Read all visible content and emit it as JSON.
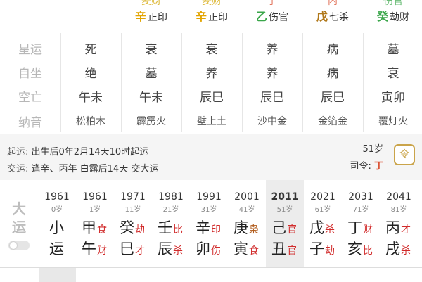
{
  "top_row": [
    {
      "cut": "羑财",
      "stem": "辛",
      "god": "正印"
    },
    {
      "cut": "羑财",
      "stem": "辛",
      "god": "正印"
    },
    {
      "cut": "了",
      "stem": "乙",
      "god": "伤官"
    },
    {
      "cut": "内",
      "stem": "戊",
      "god": "七杀"
    },
    {
      "cut": "伤官",
      "stem": "癸",
      "god": "劫财"
    }
  ],
  "rows": [
    {
      "label": "星运",
      "values": [
        "死",
        "衰",
        "衰",
        "养",
        "病",
        "墓"
      ]
    },
    {
      "label": "自坐",
      "values": [
        "绝",
        "墓",
        "养",
        "养",
        "病",
        "衰"
      ]
    },
    {
      "label": "空亡",
      "values": [
        "午未",
        "午未",
        "辰巳",
        "辰巳",
        "辰巳",
        "寅卯"
      ]
    },
    {
      "label": "纳音",
      "values": [
        "松柏木",
        "霹雳火",
        "壁上土",
        "沙中金",
        "金箔金",
        "覆灯火"
      ]
    }
  ],
  "info": {
    "qiyun_label": "起运:",
    "qiyun_text": "出生后0年2月14天10时起运",
    "jiaoyun_label": "交运:",
    "jiaoyun_text": "逢辛、丙年 白露后14天 交大运",
    "age": "51岁",
    "siling_label": "司令:",
    "siling_value": "丁",
    "icon_glyph": "令"
  },
  "dayun": {
    "title_1": "大",
    "title_2": "运",
    "columns": [
      {
        "year": "1961",
        "age": "0岁",
        "g1": "小",
        "t1": "",
        "g2": "运",
        "t2": ""
      },
      {
        "year": "1961",
        "age": "1岁",
        "g1": "甲",
        "t1": "食",
        "g2": "午",
        "t2": "财"
      },
      {
        "year": "1971",
        "age": "11岁",
        "g1": "癸",
        "t1": "劫",
        "g2": "巳",
        "t2": "才"
      },
      {
        "year": "1981",
        "age": "21岁",
        "g1": "壬",
        "t1": "比",
        "g2": "辰",
        "t2": "杀"
      },
      {
        "year": "1991",
        "age": "31岁",
        "g1": "辛",
        "t1": "印",
        "g2": "卯",
        "t2": "伤"
      },
      {
        "year": "2001",
        "age": "41岁",
        "g1": "庚",
        "t1": "枭",
        "g2": "寅",
        "t2": "食"
      },
      {
        "year": "2011",
        "age": "51岁",
        "g1": "己",
        "t1": "官",
        "g2": "丑",
        "t2": "官"
      },
      {
        "year": "2021",
        "age": "61岁",
        "g1": "戊",
        "t1": "杀",
        "g2": "子",
        "t2": "劫"
      },
      {
        "year": "2031",
        "age": "71岁",
        "g1": "丁",
        "t1": "财",
        "g2": "亥",
        "t2": "比"
      },
      {
        "year": "2041",
        "age": "81岁",
        "g1": "丙",
        "t1": "才",
        "g2": "戌",
        "t2": "杀"
      }
    ]
  }
}
